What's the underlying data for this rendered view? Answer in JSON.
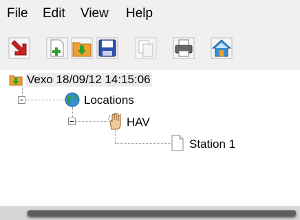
{
  "menu": {
    "items": [
      "File",
      "Edit",
      "View",
      "Help"
    ]
  },
  "toolbar": {
    "buttons": [
      "import-red-arrow",
      "add-new",
      "import-folder",
      "save-disk",
      "copy-disabled",
      "print",
      "home"
    ]
  },
  "tree": {
    "root": {
      "label": "Vexo 18/09/12 14:15:06",
      "icon": "database-import-icon"
    },
    "locations": {
      "label": "Locations",
      "icon": "globe-icon"
    },
    "hav": {
      "label": "HAV",
      "icon": "hand-vibration-icon"
    },
    "station": {
      "label": "Station 1",
      "icon": "document-icon"
    }
  },
  "colors": {
    "menubar": "#f0f0f0",
    "accent_red": "#cc2222",
    "folder_orange": "#f0a030",
    "save_blue": "#3050b0"
  }
}
